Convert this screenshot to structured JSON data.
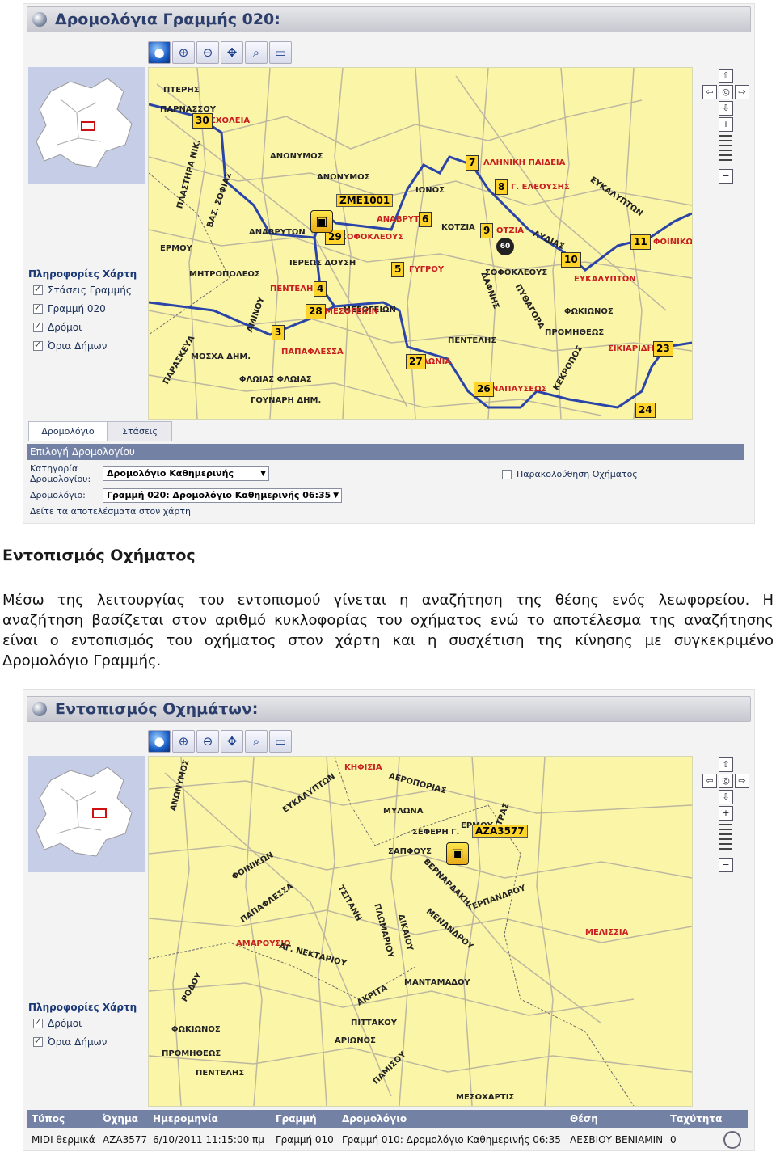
{
  "panel1": {
    "title": "Δρομολόγια Γραμμής 020:",
    "toolbar": [
      "globe-icon",
      "zoom-in-icon",
      "zoom-out-icon",
      "pan-icon",
      "zoom-window-icon",
      "measure-icon"
    ],
    "map_info": {
      "title": "Πληροφορίες Χάρτη",
      "layers": [
        {
          "label": "Στάσεις Γραμμής",
          "checked": true
        },
        {
          "label": "Γραμμή 020",
          "checked": true
        },
        {
          "label": "Δρόμοι",
          "checked": true
        },
        {
          "label": "Όρια Δήμων",
          "checked": true
        }
      ]
    },
    "streets": [
      "ΠΤΕΡΗΣ",
      "ΠΑΡΝΑΣΣΟΥ",
      "ΠΛΑΣΤΗΡΑ ΝΙΚ.",
      "ΒΑΣ. ΣΟΦΙΑΣ",
      "ΑΝΑΒΡΥΤΩΝ",
      "ΕΡΜΟΥ",
      "ΙΕΡΕΩΣ ΔΟΥΣΗ",
      "ΜΗΤΡΟΠΟΛΕΩΣ",
      "ΠΕΝΤΕΛΗΣ",
      "ΜΕΣΟΓΕΙΩΝ",
      "ΑΜΙΝΟΥ",
      "ΠΑΡΑΣΚΕΥΑ",
      "ΜΟΣΧΑ ΔΗΜ.",
      "ΦΛΩΙΑΣ ΦΛΩΙΑΣ",
      "ΓΟΥΝΑΡΗ ΔΗΜ.",
      "ΑΝΩΝΥΜΟΣ",
      "ΙΩΝΟΣ",
      "ΚΟΤΖΙΑ",
      "ΛΥΔΙΑΣ",
      "ΣΟΦΟΚΛΕΟΥΣ",
      "ΦΩΚΙΩΝΟΣ",
      "ΠΡΟΜΗΘΕΩΣ",
      "ΠΕΝΤΕΛΗΣ",
      "ΔΑΦΝΗΣ",
      "ΠΥΘΑΓΟΡΑ",
      "ΚΕΚΡΟΠΟΣ",
      "ΕΥΚΑΛΥΠΤΩΝ",
      "ΣΙΚΙΑΡΙΔΗ",
      "ΑΝΩΝΥΜΟΣ"
    ],
    "route_labels": [
      "ΣΧΟΛΕΙΑ",
      "ΑΝΑΒΡΥΤ",
      "ΣΟΦΟΚΛΕΟΥΣ",
      "ΛΛΗΝΙΚΗ ΠΑΙΔΕΙΑ",
      "Γ. ΕΛΕΟΥΣΗΣ",
      "ΟΤΖΙΑ",
      "ΦΟΙΝΙΚΩΝ",
      "ΕΥΚΑΛΥΠΤΩΝ",
      "ΣΙΚΙΑΡΙΔΗ",
      "ΓΥΓΡΟΥ",
      "ΠΕΝΤΕΛΗ",
      "ΜΕΣΟΓΕΙΩΝ",
      "ΠΑΠΑΦΛΕΣΣΑ",
      "ΛΩΝΙΑ",
      "ΝΑΠΑΥΣΕΩΣ"
    ],
    "stops": [
      "30",
      "7",
      "8",
      "6",
      "9",
      "29",
      "5",
      "10",
      "11",
      "4",
      "28",
      "3",
      "27",
      "23",
      "26",
      "24"
    ],
    "vehicle_plate": "ZME1001",
    "speed": "60",
    "tabs": [
      "Δρομολόγιο",
      "Στάσεις"
    ],
    "section_bar": "Επιλογή Δρομολογίου",
    "form": {
      "category_label_1": "Κατηγορία",
      "category_label_2": "Δρομολογίου:",
      "category_value": "Δρομολόγιο Καθημερινής",
      "route_label": "Δρομολόγιο:",
      "route_value": "Γραμμή 020: Δρομολόγιο Καθημερινής 06:35",
      "hint": "Δείτε τα αποτελέσματα στον χάρτη",
      "track_label": "Παρακολούθηση Οχήματος",
      "track_checked": false
    }
  },
  "prose": {
    "heading": "Εντοπισμός Οχήματος",
    "line1": "Μέσω της λειτουργίας του εντοπισμού γίνεται η αναζήτηση της θέσης ενός λεωφορείου. Η",
    "line2": "αναζήτηση βασίζεται στον αριθμό κυκλοφορίας του οχήματος ενώ το αποτέλεσμα της αναζήτησης",
    "line3": "είναι ο εντοπισμός του οχήματος στον χάρτη και η συσχέτιση της κίνησης με συγκεκριμένο",
    "line4": "Δρομολόγιο Γραμμής."
  },
  "panel2": {
    "title": "Εντοπισμός Οχημάτων:",
    "map_info": {
      "title": "Πληροφορίες Χάρτη",
      "layers": [
        {
          "label": "Δρόμοι",
          "checked": true
        },
        {
          "label": "Όρια Δήμων",
          "checked": true
        }
      ]
    },
    "areas": [
      "ΚΗΦΙΣΙΑ",
      "ΑΜΑΡΟΥΣΙΟ",
      "ΜΕΛΙΣΣΙΑ"
    ],
    "streets": [
      "ΑΝΩΝΥΜΟΣ",
      "ΕΥΚΑΛΥΠΤΩΝ",
      "ΦΟΙΝΙΚΩΝ",
      "ΑΕΡΟΠΟΡΙΑΣ",
      "ΜΥΛΩΝΑ",
      "ΣΕΦΕΡΗ Γ.",
      "ΣΑΠΦΟΥΣ",
      "ΒΕΡΝΑΡΔΑΚΗ",
      "ΤΕΡΠΑΝΔΡΟΥ",
      "ΤΣΙΤΑΝΗ",
      "ΠΛΩΜΑΡΙΟΥ",
      "ΔΙΚΑΙΟΥ",
      "ΜΕΝΑΝΔΡΟΥ",
      "ΠΑΠΑΦΛΕΣΣΑ",
      "ΑΓ. ΝΕΚΤΑΡΙΟΥ",
      "ΜΑΝΤΑΜΑΔΟΥ",
      "ΑΚΡΙΤΑ",
      "ΦΩΚΙΩΝΟΣ",
      "ΠΡΟΜΗΘΕΩΣ",
      "ΠΕΝΤΕΛΗΣ",
      "ΠΙΤΤΑΚΟΥ",
      "ΑΡΙΩΝΟΣ",
      "ΜΕΣΟΧΑΡΤΙΣ",
      "ΠΑΜΙΣΟΥ",
      "ΡΟΔΟΥ",
      "ΤΡΑΣ",
      "ΕΡΜΟΥ"
    ],
    "vehicle_plate": "AZA3577",
    "table": {
      "headers": [
        "Τύπος",
        "Όχημα",
        "Ημερομηνία",
        "Γραμμή",
        "Δρομολόγιο",
        "Θέση",
        "Ταχύτητα"
      ],
      "row": [
        "MIDI θερμικά",
        "AZA3577",
        "6/10/2011 11:15:00 πμ",
        "Γραμμή 010",
        "Γραμμή 010: Δρομολόγιο Καθημερινής 06:35",
        "ΛΕΣΒΙΟΥ ΒΕΝΙΑΜΙΝ",
        "0"
      ]
    }
  }
}
